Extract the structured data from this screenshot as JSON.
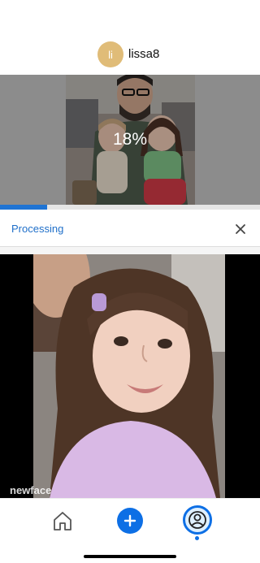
{
  "header": {
    "avatar_initials": "li",
    "username": "lissa8"
  },
  "upload": {
    "progress_text": "18%",
    "progress_fraction": 0.18,
    "thumbnail": "family-photo"
  },
  "status": {
    "label": "Processing",
    "close_icon": "close-icon"
  },
  "video": {
    "watermark": "newface",
    "subject": "child-selfie-video"
  },
  "nav": {
    "items": [
      {
        "icon": "home-icon"
      },
      {
        "icon": "plus-icon"
      },
      {
        "icon": "profile-icon"
      }
    ],
    "accent_color": "#0d6fe5"
  },
  "colors": {
    "accent": "#1f74d4",
    "avatar_bg": "#e0bc78"
  }
}
